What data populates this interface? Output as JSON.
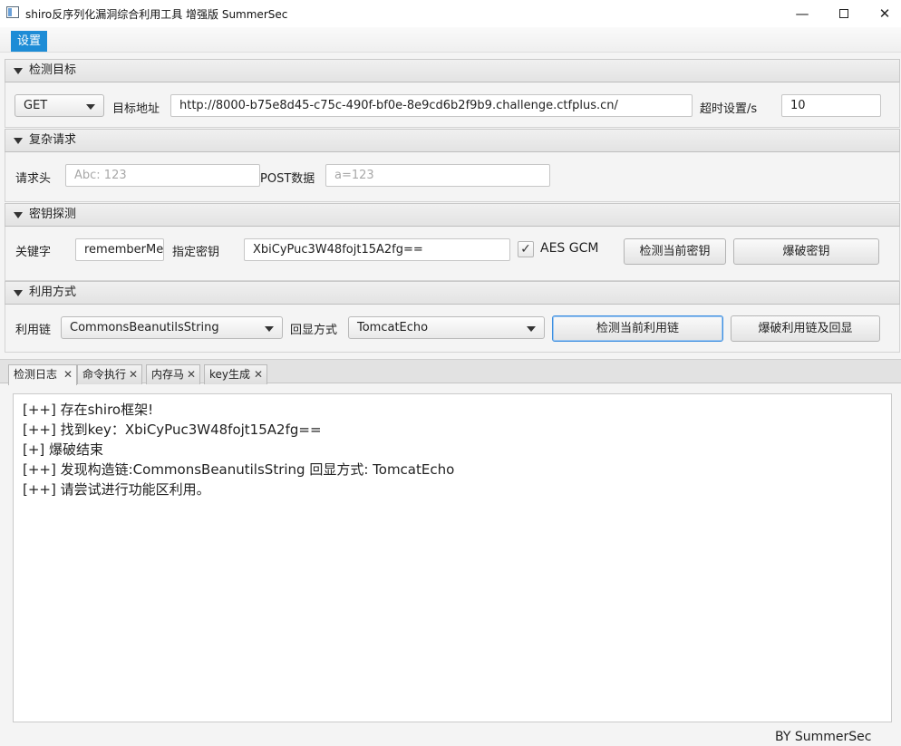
{
  "window": {
    "title": "shiro反序列化漏洞综合利用工具 增强版 SummerSec",
    "min_glyph": "—",
    "close_glyph": "✕"
  },
  "menu": {
    "settings": "设置"
  },
  "sections": {
    "target": {
      "title": "检测目标",
      "method": "GET",
      "url_label": "目标地址",
      "url_value": "http://8000-b75e8d45-c75c-490f-bf0e-8e9cd6b2f9b9.challenge.ctfplus.cn/",
      "timeout_label": "超时设置/s",
      "timeout_value": "10"
    },
    "complex": {
      "title": "复杂请求",
      "header_label": "请求头",
      "header_placeholder": "Abc: 123",
      "post_label": "POST数据",
      "post_placeholder": "a=123"
    },
    "key": {
      "title": "密钥探测",
      "keyword_label": "关键字",
      "keyword_value": "rememberMe",
      "key_label": "指定密钥",
      "key_value": "XbiCyPuc3W48fojt15A2fg==",
      "aes_gcm_label": "AES GCM",
      "aes_gcm_checked": true,
      "check_mark": "✓",
      "check_button": "检测当前密钥",
      "brute_button": "爆破密钥"
    },
    "exploit": {
      "title": "利用方式",
      "chain_label": "利用链",
      "chain_value": "CommonsBeanutilsString",
      "echo_label": "回显方式",
      "echo_value": "TomcatEcho",
      "check_button": "检测当前利用链",
      "brute_button": "爆破利用链及回显"
    }
  },
  "tabs": [
    {
      "label": "检测日志",
      "close": "✕"
    },
    {
      "label": "命令执行",
      "close": "✕"
    },
    {
      "label": "内存马",
      "close": "✕"
    },
    {
      "label": "key生成",
      "close": "✕"
    }
  ],
  "log": [
    "[++] 存在shiro框架!",
    "[++] 找到key：XbiCyPuc3W48fojt15A2fg==",
    "[+] 爆破结束",
    "[++] 发现构造链:CommonsBeanutilsString  回显方式: TomcatEcho",
    "[++] 请尝试进行功能区利用。"
  ],
  "footer": "BY   SummerSec"
}
